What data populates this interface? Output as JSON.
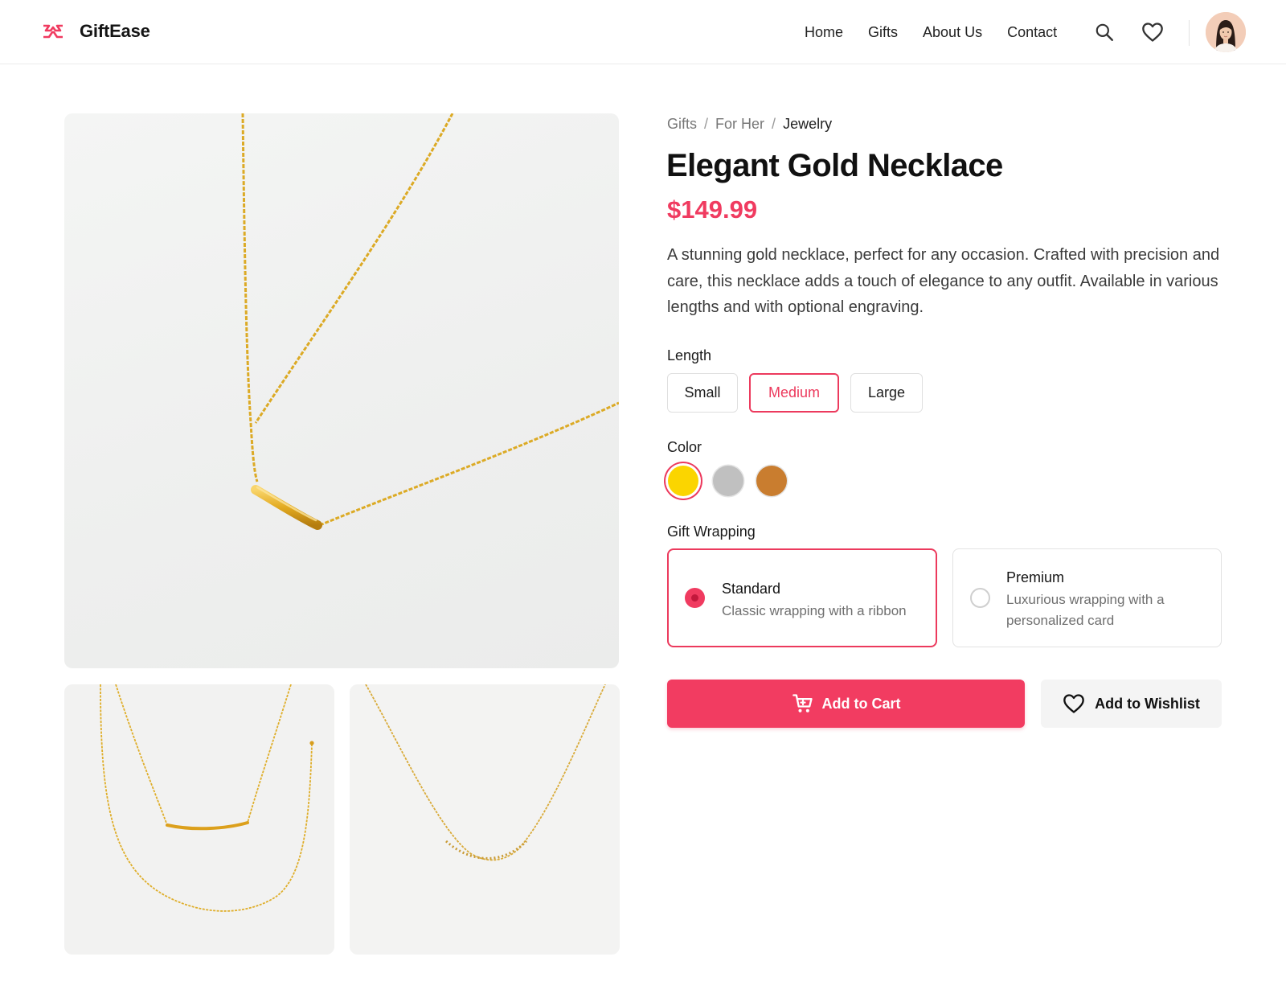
{
  "brand": {
    "name": "GiftEase",
    "logo_icon": "giftease-logo-icon",
    "accent_color": "#f03b60"
  },
  "nav": {
    "items": [
      "Home",
      "Gifts",
      "About Us",
      "Contact"
    ],
    "search_icon": "search-icon",
    "wishlist_icon": "heart-icon"
  },
  "breadcrumb": [
    "Gifts",
    "For Her",
    "Jewelry"
  ],
  "product": {
    "title": "Elegant Gold Necklace",
    "price": "$149.99",
    "description": "A stunning gold necklace, perfect for any occasion. Crafted with precision and care, this necklace adds a touch of elegance to any outfit. Available in various lengths and with optional engraving."
  },
  "length": {
    "label": "Length",
    "options": [
      "Small",
      "Medium",
      "Large"
    ],
    "selected": "Medium"
  },
  "color": {
    "label": "Color",
    "options": [
      {
        "name": "gold",
        "hex": "#fbd500"
      },
      {
        "name": "silver",
        "hex": "#c0c0c0"
      },
      {
        "name": "bronze",
        "hex": "#c97d2f"
      }
    ],
    "selected": "gold"
  },
  "wrapping": {
    "label": "Gift Wrapping",
    "options": [
      {
        "name": "Standard",
        "description": "Classic wrapping with a ribbon"
      },
      {
        "name": "Premium",
        "description": "Luxurious wrapping with a personalized card"
      }
    ],
    "selected": "Standard"
  },
  "actions": {
    "add_to_cart": "Add to Cart",
    "add_to_wishlist": "Add to Wishlist"
  }
}
